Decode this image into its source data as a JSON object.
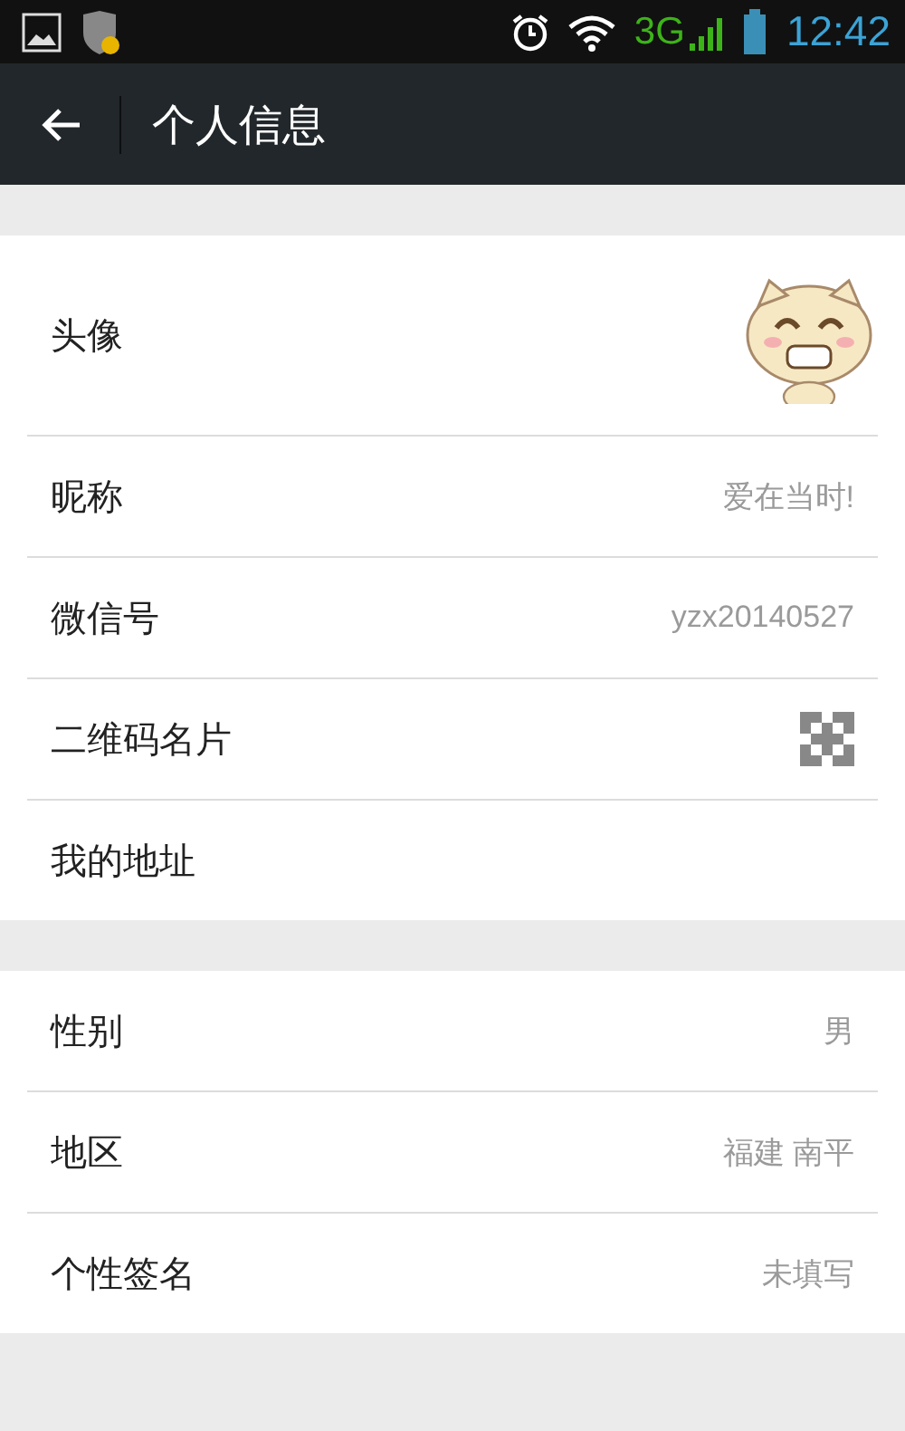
{
  "status_bar": {
    "network": "3G",
    "time": "12:42"
  },
  "title_bar": {
    "title": "个人信息"
  },
  "sections": [
    {
      "rows": [
        {
          "kind": "avatar",
          "label": "头像"
        },
        {
          "kind": "text",
          "label": "昵称",
          "value": "爱在当时!"
        },
        {
          "kind": "text",
          "label": "微信号",
          "value": "yzx20140527"
        },
        {
          "kind": "qr",
          "label": "二维码名片"
        },
        {
          "kind": "empty",
          "label": "我的地址"
        }
      ]
    },
    {
      "rows": [
        {
          "kind": "text",
          "label": "性别",
          "value": "男"
        },
        {
          "kind": "text",
          "label": "地区",
          "value": "福建 南平"
        },
        {
          "kind": "text",
          "label": "个性签名",
          "value": "未填写"
        }
      ]
    }
  ]
}
